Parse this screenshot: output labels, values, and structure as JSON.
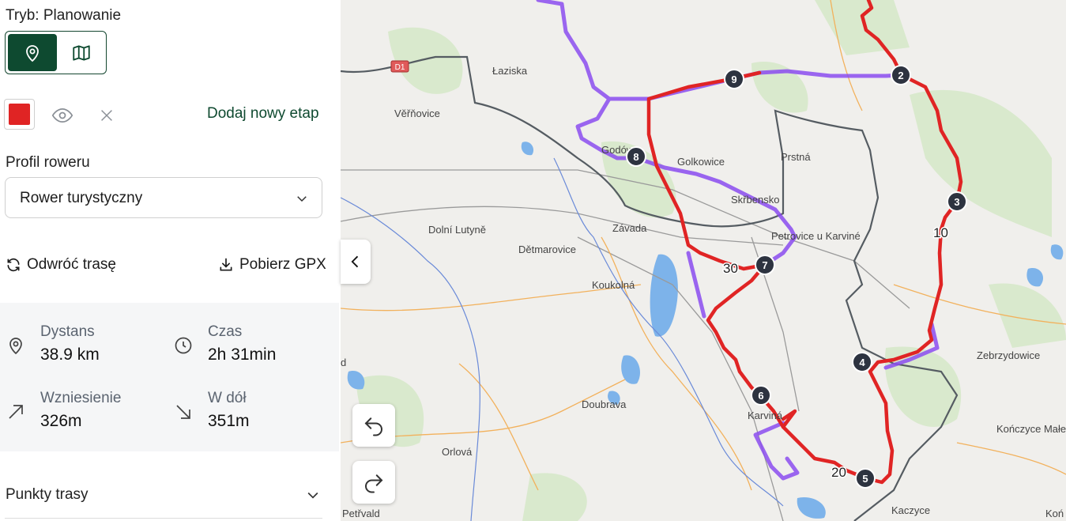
{
  "mode": {
    "label": "Tryb: Planowanie"
  },
  "stage": {
    "color": "#e02424",
    "add_label": "Dodaj nowy etap"
  },
  "profile": {
    "label": "Profil roweru",
    "selected": "Rower turystyczny"
  },
  "actions": {
    "reverse": "Odwróć trasę",
    "gpx": "Pobierz GPX"
  },
  "stats": {
    "distance": {
      "label": "Dystans",
      "value": "38.9 km"
    },
    "time": {
      "label": "Czas",
      "value": "2h 31min"
    },
    "ascent": {
      "label": "Wzniesienie",
      "value": "326m"
    },
    "descent": {
      "label": "W dół",
      "value": "351m"
    }
  },
  "points": {
    "label": "Punkty trasy"
  },
  "map": {
    "colors": {
      "route": "#e02424",
      "alt_route": "#8b4cf0",
      "accent": "#0e4a30",
      "water": "#7db3ea",
      "forest": "#d8e8cc"
    },
    "road_badge": "D1",
    "places": [
      "Łaziska",
      "Věřňovice",
      "Godów",
      "Golkowice",
      "Prstná",
      "Skřbensko",
      "Dolní Lutyně",
      "Závada",
      "Petrovice u Karviné",
      "Dětmarovice",
      "Koukolná",
      "Zebrzydowice",
      "Doubrava",
      "Karviná",
      "Orlová",
      "Kończyce Małe",
      "Kaczyce",
      "Koń",
      "Petřvald",
      "d"
    ],
    "waypoints": [
      "2",
      "3",
      "4",
      "5",
      "6",
      "7",
      "8",
      "9"
    ],
    "km_markers": [
      "10",
      "20",
      "30"
    ]
  }
}
